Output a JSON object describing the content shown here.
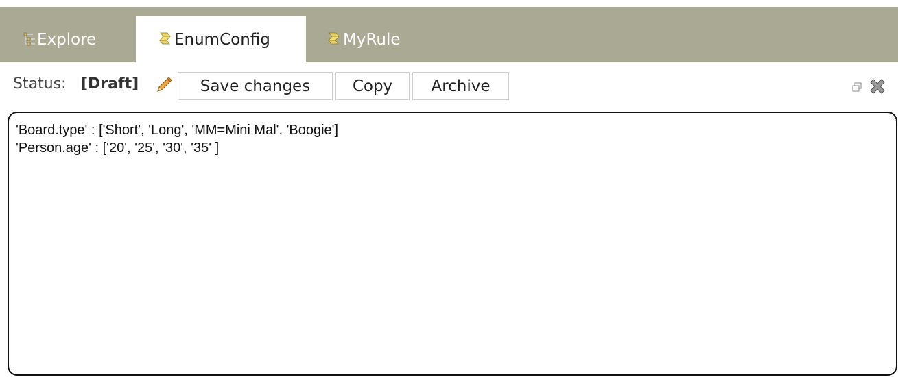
{
  "tabs": [
    {
      "label": "Explore",
      "icon": "tree-icon",
      "active": false
    },
    {
      "label": "EnumConfig",
      "icon": "enum-icon",
      "active": true
    },
    {
      "label": "MyRule",
      "icon": "rule-icon",
      "active": false
    }
  ],
  "toolbar": {
    "status_label": "Status:",
    "status_value": "[Draft]",
    "save_label": "Save changes",
    "copy_label": "Copy",
    "archive_label": "Archive"
  },
  "editor": {
    "content": "'Board.type' : ['Short', 'Long', 'MM=Mini Mal', 'Boogie']\n'Person.age' : ['20', '25', '30', '35' ]"
  },
  "colors": {
    "tabbar_bg": "#a9a994",
    "active_tab_bg": "#ffffff",
    "inactive_tab_text": "#ffffff"
  }
}
